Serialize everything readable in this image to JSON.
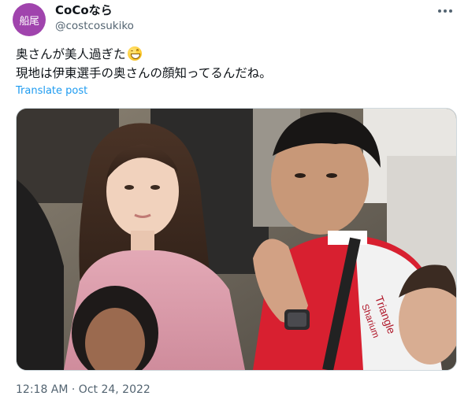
{
  "author": {
    "avatar_text": "船尾",
    "display_name": "CoCoなら",
    "handle": "@costcosukiko"
  },
  "tweet": {
    "line1": "奥さんが美人過ぎた",
    "line2": "現地は伊東選手の奥さんの顔知ってるんだね。",
    "emoji_icon": "grinning-face-icon"
  },
  "actions": {
    "translate_label": "Translate post",
    "more_icon": "more-options-icon"
  },
  "media": {
    "jersey_text": "Triangle",
    "jersey_text2": "Sharium"
  },
  "meta": {
    "timestamp": "12:18 AM · Oct 24, 2022"
  },
  "colors": {
    "link": "#1d9bf0",
    "avatar": "#a044ad",
    "secondary_text": "#536471"
  }
}
